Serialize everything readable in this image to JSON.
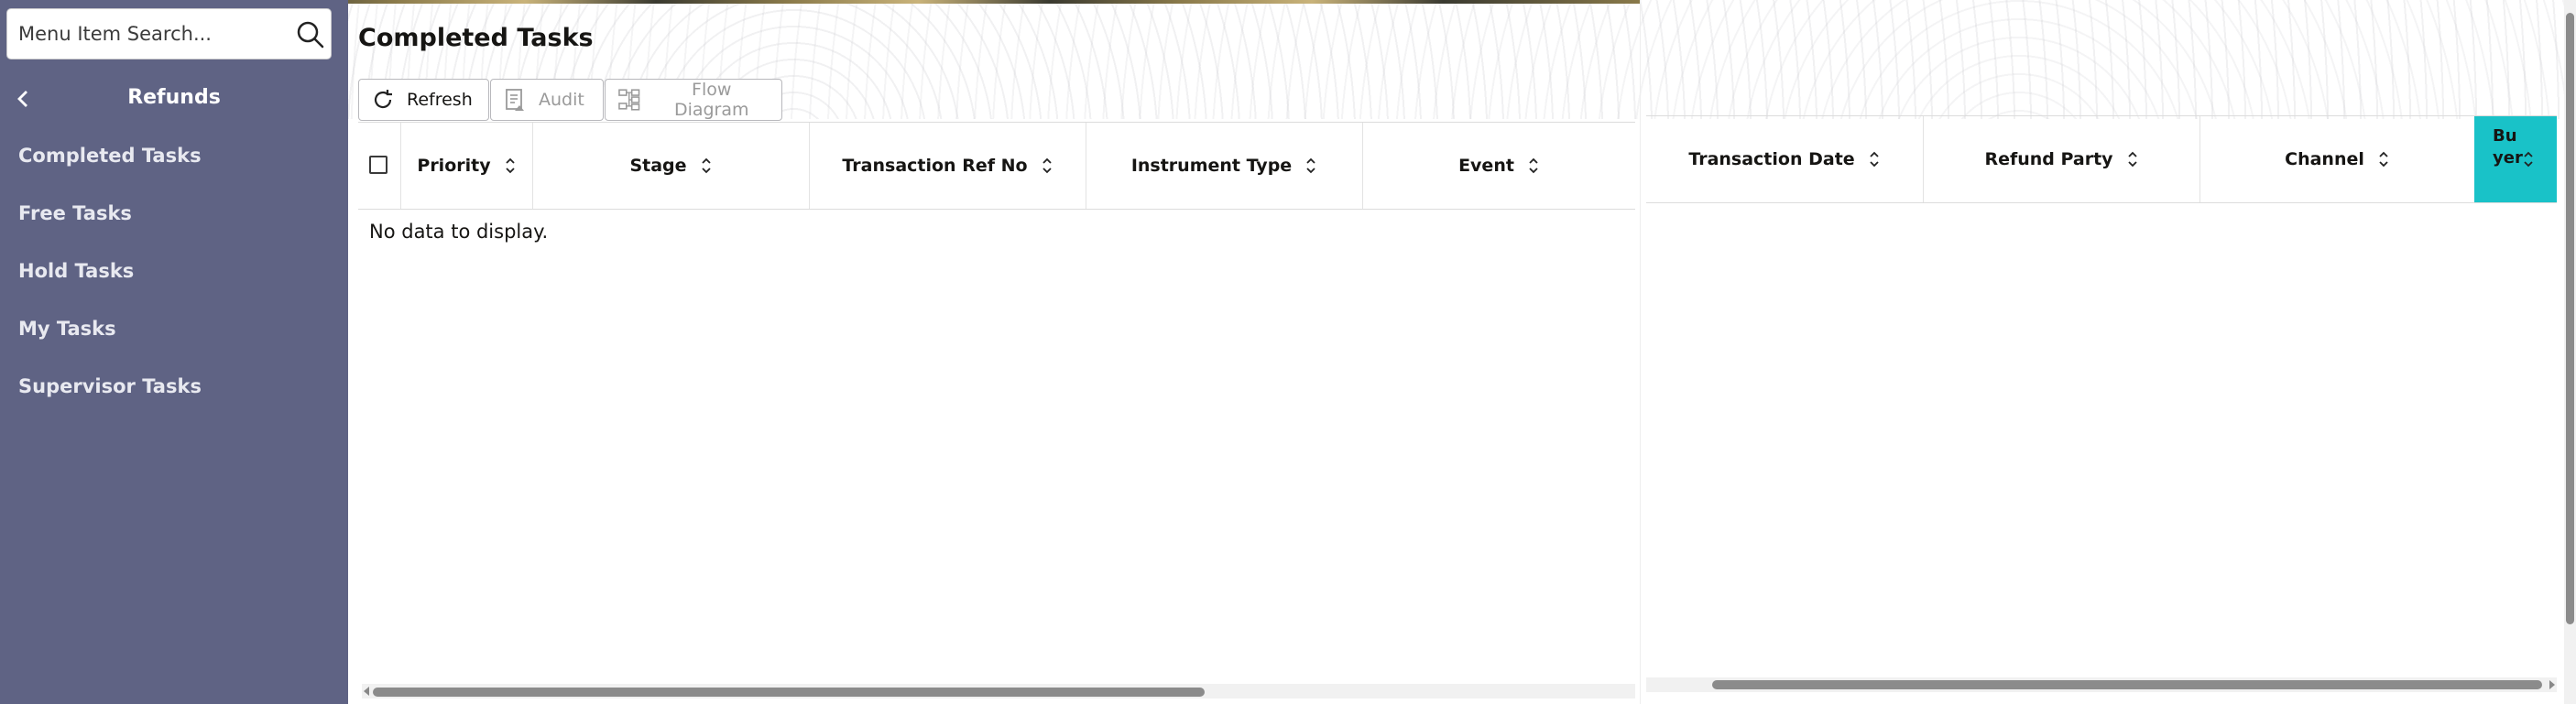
{
  "sidebar": {
    "search": {
      "placeholder": "Menu Item Search...",
      "icon": "search-icon"
    },
    "back_title": "Refunds",
    "items": [
      {
        "label": "Completed Tasks"
      },
      {
        "label": "Free Tasks"
      },
      {
        "label": "Hold Tasks"
      },
      {
        "label": "My Tasks"
      },
      {
        "label": "Supervisor Tasks"
      }
    ]
  },
  "main": {
    "title": "Completed Tasks",
    "toolbar": {
      "refresh_label": "Refresh",
      "audit_label": "Audit",
      "flow_label": "Flow Diagram"
    },
    "left_columns": [
      "Priority",
      "Stage",
      "Transaction Ref No",
      "Instrument Type",
      "Event"
    ],
    "empty_message": "No data to display.",
    "right_columns": [
      "Transaction Date",
      "Refund Party",
      "Channel"
    ],
    "highlight_column": "Buyer"
  },
  "colors": {
    "sidebar_bg": "#5f6384",
    "highlight_col": "#19c2c8"
  }
}
